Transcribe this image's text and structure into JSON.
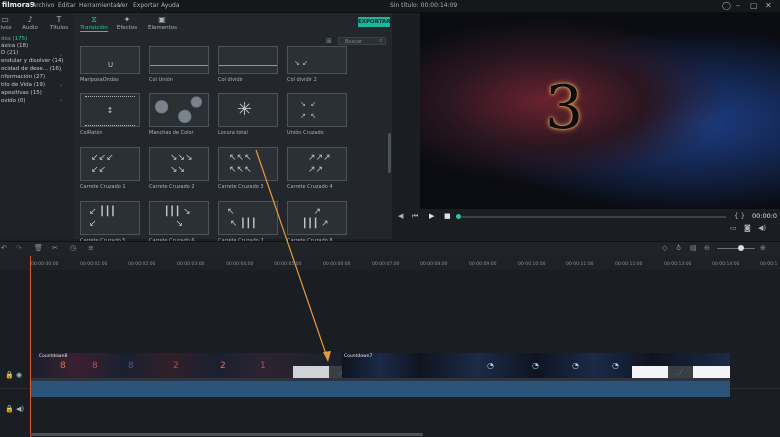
{
  "app": {
    "logo": "filmora9"
  },
  "menu": [
    "Archivo",
    "Editar",
    "Herramientas",
    "Ver",
    "Exportar",
    "Ayuda"
  ],
  "window": {
    "title": "Sin título: 00:00:14:09"
  },
  "left_tabs": [
    {
      "label": "tivos",
      "icon": "folder-icon"
    },
    {
      "label": "Audio",
      "icon": "music-icon"
    },
    {
      "label": "Títulos",
      "icon": "title-icon"
    }
  ],
  "lib_tabs": [
    {
      "label": "Transición",
      "icon": "transition-icon"
    },
    {
      "label": "Efectos",
      "icon": "effects-icon"
    },
    {
      "label": "Elementos",
      "icon": "elements-icon"
    }
  ],
  "export_label": "EXPORTAR",
  "search_placeholder": "Buscar",
  "categories": [
    "dos (175)",
    "ásica (18)",
    "D (21)",
    "endular y disolver (14)",
    "ocidad de dese... (16)",
    "nformación (27)",
    "tilo de Vida (19)",
    "apositivas (15)",
    "ovido (0)"
  ],
  "transitions": [
    {
      "label": "MariposaOndas",
      "icon": "butterfly-wave-icon"
    },
    {
      "label": "Col Unión",
      "icon": "col-union-icon"
    },
    {
      "label": "Col dividir",
      "icon": "col-split-icon"
    },
    {
      "label": "Col dividir 2",
      "icon": "col-split2-icon"
    },
    {
      "label": "ColRatón",
      "icon": "col-mouse-icon"
    },
    {
      "label": "Manchas de Color",
      "icon": "color-spots-icon"
    },
    {
      "label": "Locura total",
      "icon": "total-madness-icon"
    },
    {
      "label": "Unión Cruzado",
      "icon": "cross-union-icon"
    },
    {
      "label": "Carrete Cruzado 1",
      "icon": "cross-reel-1-icon"
    },
    {
      "label": "Carrete Cruzado 2",
      "icon": "cross-reel-2-icon"
    },
    {
      "label": "Carrete Cruzado 3",
      "icon": "cross-reel-3-icon"
    },
    {
      "label": "Carrete Cruzado 4",
      "icon": "cross-reel-4-icon"
    },
    {
      "label": "Carrete Cruzado 5",
      "icon": "cross-reel-5-icon"
    },
    {
      "label": "Carrete Cruzado 6",
      "icon": "cross-reel-6-icon"
    },
    {
      "label": "Carrete Cruzado 7",
      "icon": "cross-reel-7-icon"
    },
    {
      "label": "Carrete Cruzado 8",
      "icon": "cross-reel-8-icon"
    }
  ],
  "preview": {
    "timecode": "00:00:0",
    "progress": 0.0
  },
  "ruler": [
    "00:00:00:00",
    "00:00:01:00",
    "00:00:02:00",
    "00:00:03:00",
    "00:00:04:00",
    "00:00:05:00",
    "00:00:06:00",
    "00:00:07:00",
    "00:00:08:00",
    "00:00:09:00",
    "00:00:10:00",
    "00:00:11:00",
    "00:00:12:00",
    "00:00:13:00",
    "00:00:14:00",
    "00:00:1"
  ],
  "clips": [
    {
      "name": "Countdown8"
    },
    {
      "name": "Countdown7"
    }
  ],
  "colors": {
    "accent": "#23c6ae",
    "playhead": "#e3572c",
    "audio_track": "#2c5478",
    "annotation_arrow": "#e39a3a"
  }
}
